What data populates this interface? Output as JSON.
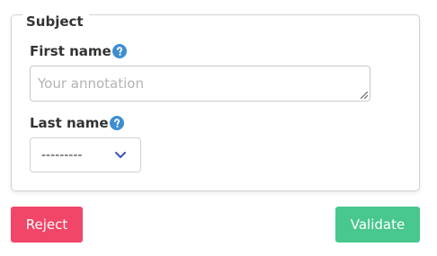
{
  "subject_panel": {
    "legend": "Subject",
    "first_name": {
      "label": "First name",
      "help_icon": "question-circle-icon",
      "placeholder": "Your annotation"
    },
    "last_name": {
      "label": "Last name",
      "help_icon": "question-circle-icon",
      "selected_value": "---------",
      "chevron_icon": "chevron-down-icon"
    }
  },
  "actions": {
    "reject_label": "Reject",
    "validate_label": "Validate"
  },
  "colors": {
    "help_icon": "#3e8ed0",
    "reject": "#f14668",
    "validate": "#48c78e",
    "chevron": "#3f51b5"
  }
}
